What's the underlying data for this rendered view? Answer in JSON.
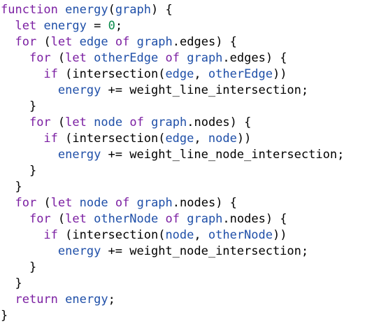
{
  "colors": {
    "keyword": "#7b1fa2",
    "identifier": "#1f4fa8",
    "number": "#0a8a4a",
    "text": "#000000",
    "background": "#ffffff"
  },
  "code": {
    "lines": [
      [
        {
          "t": "function",
          "c": "kw"
        },
        {
          "t": " ",
          "c": "txt"
        },
        {
          "t": "energy",
          "c": "id"
        },
        {
          "t": "(",
          "c": "txt"
        },
        {
          "t": "graph",
          "c": "id"
        },
        {
          "t": ") {",
          "c": "txt"
        }
      ],
      [
        {
          "t": "  ",
          "c": "txt"
        },
        {
          "t": "let",
          "c": "kw"
        },
        {
          "t": " ",
          "c": "txt"
        },
        {
          "t": "energy",
          "c": "id"
        },
        {
          "t": " = ",
          "c": "txt"
        },
        {
          "t": "0",
          "c": "num"
        },
        {
          "t": ";",
          "c": "txt"
        }
      ],
      [
        {
          "t": "  ",
          "c": "txt"
        },
        {
          "t": "for",
          "c": "kw"
        },
        {
          "t": " (",
          "c": "txt"
        },
        {
          "t": "let",
          "c": "kw"
        },
        {
          "t": " ",
          "c": "txt"
        },
        {
          "t": "edge",
          "c": "id"
        },
        {
          "t": " ",
          "c": "txt"
        },
        {
          "t": "of",
          "c": "kw"
        },
        {
          "t": " ",
          "c": "txt"
        },
        {
          "t": "graph",
          "c": "id"
        },
        {
          "t": ".edges) {",
          "c": "txt"
        }
      ],
      [
        {
          "t": "    ",
          "c": "txt"
        },
        {
          "t": "for",
          "c": "kw"
        },
        {
          "t": " (",
          "c": "txt"
        },
        {
          "t": "let",
          "c": "kw"
        },
        {
          "t": " ",
          "c": "txt"
        },
        {
          "t": "otherEdge",
          "c": "id"
        },
        {
          "t": " ",
          "c": "txt"
        },
        {
          "t": "of",
          "c": "kw"
        },
        {
          "t": " ",
          "c": "txt"
        },
        {
          "t": "graph",
          "c": "id"
        },
        {
          "t": ".edges) {",
          "c": "txt"
        }
      ],
      [
        {
          "t": "      ",
          "c": "txt"
        },
        {
          "t": "if",
          "c": "kw"
        },
        {
          "t": " (intersection(",
          "c": "txt"
        },
        {
          "t": "edge",
          "c": "id"
        },
        {
          "t": ", ",
          "c": "txt"
        },
        {
          "t": "otherEdge",
          "c": "id"
        },
        {
          "t": "))",
          "c": "txt"
        }
      ],
      [
        {
          "t": "        ",
          "c": "txt"
        },
        {
          "t": "energy",
          "c": "id"
        },
        {
          "t": " += weight_line_intersection;",
          "c": "txt"
        }
      ],
      [
        {
          "t": "    }",
          "c": "txt"
        }
      ],
      [
        {
          "t": "    ",
          "c": "txt"
        },
        {
          "t": "for",
          "c": "kw"
        },
        {
          "t": " (",
          "c": "txt"
        },
        {
          "t": "let",
          "c": "kw"
        },
        {
          "t": " ",
          "c": "txt"
        },
        {
          "t": "node",
          "c": "id"
        },
        {
          "t": " ",
          "c": "txt"
        },
        {
          "t": "of",
          "c": "kw"
        },
        {
          "t": " ",
          "c": "txt"
        },
        {
          "t": "graph",
          "c": "id"
        },
        {
          "t": ".nodes) {",
          "c": "txt"
        }
      ],
      [
        {
          "t": "      ",
          "c": "txt"
        },
        {
          "t": "if",
          "c": "kw"
        },
        {
          "t": " (intersection(",
          "c": "txt"
        },
        {
          "t": "edge",
          "c": "id"
        },
        {
          "t": ", ",
          "c": "txt"
        },
        {
          "t": "node",
          "c": "id"
        },
        {
          "t": "))",
          "c": "txt"
        }
      ],
      [
        {
          "t": "        ",
          "c": "txt"
        },
        {
          "t": "energy",
          "c": "id"
        },
        {
          "t": " += weight_line_node_intersection;",
          "c": "txt"
        }
      ],
      [
        {
          "t": "    }",
          "c": "txt"
        }
      ],
      [
        {
          "t": "  }",
          "c": "txt"
        }
      ],
      [
        {
          "t": "  ",
          "c": "txt"
        },
        {
          "t": "for",
          "c": "kw"
        },
        {
          "t": " (",
          "c": "txt"
        },
        {
          "t": "let",
          "c": "kw"
        },
        {
          "t": " ",
          "c": "txt"
        },
        {
          "t": "node",
          "c": "id"
        },
        {
          "t": " ",
          "c": "txt"
        },
        {
          "t": "of",
          "c": "kw"
        },
        {
          "t": " ",
          "c": "txt"
        },
        {
          "t": "graph",
          "c": "id"
        },
        {
          "t": ".nodes) {",
          "c": "txt"
        }
      ],
      [
        {
          "t": "    ",
          "c": "txt"
        },
        {
          "t": "for",
          "c": "kw"
        },
        {
          "t": " (",
          "c": "txt"
        },
        {
          "t": "let",
          "c": "kw"
        },
        {
          "t": " ",
          "c": "txt"
        },
        {
          "t": "otherNode",
          "c": "id"
        },
        {
          "t": " ",
          "c": "txt"
        },
        {
          "t": "of",
          "c": "kw"
        },
        {
          "t": " ",
          "c": "txt"
        },
        {
          "t": "graph",
          "c": "id"
        },
        {
          "t": ".nodes) {",
          "c": "txt"
        }
      ],
      [
        {
          "t": "      ",
          "c": "txt"
        },
        {
          "t": "if",
          "c": "kw"
        },
        {
          "t": " (intersection(",
          "c": "txt"
        },
        {
          "t": "node",
          "c": "id"
        },
        {
          "t": ", ",
          "c": "txt"
        },
        {
          "t": "otherNode",
          "c": "id"
        },
        {
          "t": "))",
          "c": "txt"
        }
      ],
      [
        {
          "t": "        ",
          "c": "txt"
        },
        {
          "t": "energy",
          "c": "id"
        },
        {
          "t": " += weight_node_intersection;",
          "c": "txt"
        }
      ],
      [
        {
          "t": "    }",
          "c": "txt"
        }
      ],
      [
        {
          "t": "  }",
          "c": "txt"
        }
      ],
      [
        {
          "t": "  ",
          "c": "txt"
        },
        {
          "t": "return",
          "c": "kw"
        },
        {
          "t": " ",
          "c": "txt"
        },
        {
          "t": "energy",
          "c": "id"
        },
        {
          "t": ";",
          "c": "txt"
        }
      ],
      [
        {
          "t": "}",
          "c": "txt"
        }
      ]
    ]
  }
}
